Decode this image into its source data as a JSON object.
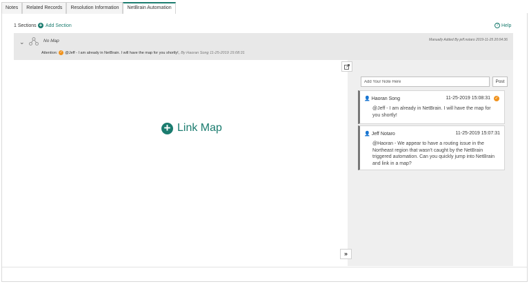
{
  "tabs": [
    {
      "label": "Notes"
    },
    {
      "label": "Related Records"
    },
    {
      "label": "Resolution Information"
    },
    {
      "label": "NetBrain Automation"
    }
  ],
  "toolbar": {
    "sections_count": "1 Sections",
    "add_section_label": "Add Section",
    "help_label": "Help"
  },
  "section": {
    "title": "No Map",
    "added_by": "Manually Added By jeff.notaro 2019-11-25 20:04:36",
    "attention_label": "Attention:",
    "attention_text": "@Jeff - I am already in NetBrain. I will have the map for you shortly!,",
    "attention_by": "By Haoran Song 11-25-2019 15:08:31"
  },
  "main": {
    "link_map_label": "Link Map"
  },
  "notes_panel": {
    "input_placeholder": "Add Your Note Here",
    "post_label": "Post",
    "notes": [
      {
        "author": "Haoran Song",
        "time": "11-25-2019 15:08:31",
        "text": "@Jeff - I am already in NetBrain. I will have the map for you shortly!"
      },
      {
        "author": "Jeff Notaro",
        "time": "11-25-2019 15:07:31",
        "text": "@Haoran - We appear to have a routing issue in the Northeast region that wasn't caught by the NetBrain triggered automation. Can you quickly jump into NetBrain and link in a map?"
      }
    ]
  },
  "colors": {
    "accent": "#1b7c6f",
    "badge": "#f0921d",
    "section_bg": "#e8e8e8",
    "panel_bg": "#efefef"
  },
  "icons": {
    "add_section": "plus-circle-icon",
    "help": "help-icon",
    "collapse": "chevron-down-icon",
    "map": "topology-icon",
    "popout": "external-link-icon",
    "expand": "double-chevron-right-icon",
    "user": "user-icon",
    "alert": "alert-badge-icon"
  }
}
